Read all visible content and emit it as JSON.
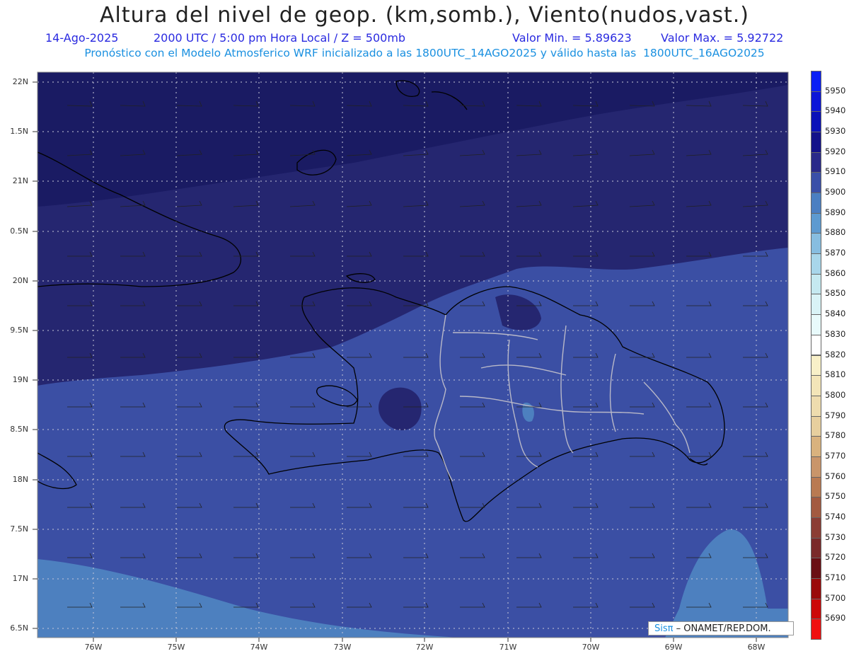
{
  "header": {
    "title": "Altura del nivel de geop. (km,somb.), Viento(nudos,vast.)",
    "date": "14-Ago-2025",
    "time": "2000 UTC / 5:00 pm Hora Local / Z = 500mb",
    "min_label": "Valor Min. = 5.89623",
    "max_label": "Valor Max. = 5.92722",
    "model_line": "Pronóstico con el Modelo Atmosferico WRF inicializado a las 1800UTC_14AGO2025 y válido hasta las  1800UTC_16AGO2025"
  },
  "credit": {
    "brand": "Sisπ",
    "text": " – ONAMET/REP.DOM."
  },
  "lat_labels": [
    "22N",
    "1.5N",
    "21N",
    "0.5N",
    "20N",
    "9.5N",
    "19N",
    "8.5N",
    "18N",
    "7.5N",
    "17N",
    "6.5N"
  ],
  "lon_labels": [
    "76W",
    "75W",
    "74W",
    "73W",
    "72W",
    "71W",
    "70W",
    "69W",
    "68W"
  ],
  "colorbar": {
    "labels": [
      "5950",
      "5940",
      "5930",
      "5920",
      "5910",
      "5900",
      "5890",
      "5880",
      "5870",
      "5860",
      "5850",
      "5840",
      "5830",
      "5820",
      "5810",
      "5800",
      "5790",
      "5780",
      "5770",
      "5760",
      "5750",
      "5740",
      "5730",
      "5720",
      "5710",
      "5700",
      "5690"
    ],
    "colors": [
      "#0a1ff5",
      "#0c16d8",
      "#0b12b8",
      "#13128a",
      "#2a2a8a",
      "#3a4fa8",
      "#4b7fc2",
      "#5d9ad0",
      "#87bde0",
      "#a8d6ea",
      "#c5e9f0",
      "#d9f3f6",
      "#e8fafb",
      "#ffffff",
      "#f8f0c8",
      "#f3e5b8",
      "#eedcae",
      "#e7cf9e",
      "#d9b27e",
      "#c9956a",
      "#b97a52",
      "#a35a40",
      "#8b3d34",
      "#7a2a2a",
      "#6a0f14",
      "#9a0a0a",
      "#cc0808",
      "#f01010"
    ]
  },
  "legend_colors": {
    "dark": "#21207a",
    "mid": "#3b4fa4",
    "light": "#4d80bf",
    "pale": "#5b8fc8"
  }
}
